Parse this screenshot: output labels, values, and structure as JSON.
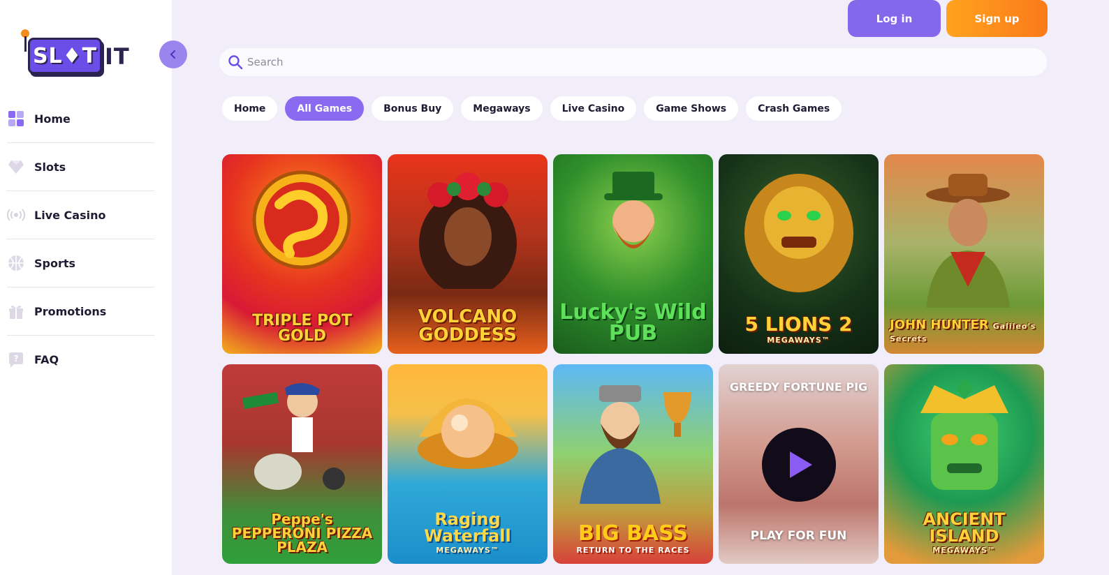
{
  "logo": {
    "box_text": "SL♦T",
    "tail_text": "IT"
  },
  "sidebar": {
    "items": [
      {
        "label": "Home",
        "icon": "grid-icon"
      },
      {
        "label": "Slots",
        "icon": "diamond-icon"
      },
      {
        "label": "Live Casino",
        "icon": "broadcast-icon"
      },
      {
        "label": "Sports",
        "icon": "ball-icon"
      },
      {
        "label": "Promotions",
        "icon": "gift-icon"
      },
      {
        "label": "FAQ",
        "icon": "question-icon"
      }
    ]
  },
  "header": {
    "login_label": "Log in",
    "signup_label": "Sign up"
  },
  "search": {
    "placeholder": "Search"
  },
  "tabs": [
    {
      "label": "Home",
      "active": false
    },
    {
      "label": "All Games",
      "active": true
    },
    {
      "label": "Bonus Buy",
      "active": false
    },
    {
      "label": "Megaways",
      "active": false
    },
    {
      "label": "Live Casino",
      "active": false
    },
    {
      "label": "Game Shows",
      "active": false
    },
    {
      "label": "Crash Games",
      "active": false
    }
  ],
  "games": [
    {
      "title": "TRIPLE POT GOLD",
      "subtitle": ""
    },
    {
      "title": "VOLCANO GODDESS",
      "subtitle": ""
    },
    {
      "title": "Lucky's Wild PUB",
      "subtitle": ""
    },
    {
      "title": "5 LIONS 2",
      "subtitle": "MEGAWAYS™"
    },
    {
      "title": "JOHN HUNTER",
      "subtitle": "Galileo's Secrets"
    },
    {
      "title": "Peppe's PEPPERONI PIZZA PLAZA",
      "subtitle": ""
    },
    {
      "title": "Raging Waterfall",
      "subtitle": "MEGAWAYS™"
    },
    {
      "title": "BIG BASS",
      "subtitle": "RETURN TO THE RACES"
    },
    {
      "title": "GREEDY FORTUNE PIG",
      "subtitle": "",
      "overlay_label": "PLAY FOR FUN"
    },
    {
      "title": "ANCIENT ISLAND",
      "subtitle": "MEGAWAYS™"
    }
  ],
  "colors": {
    "accent": "#8a6af0",
    "signup_orange": "#fb8a1c",
    "background": "#f1eef9"
  }
}
